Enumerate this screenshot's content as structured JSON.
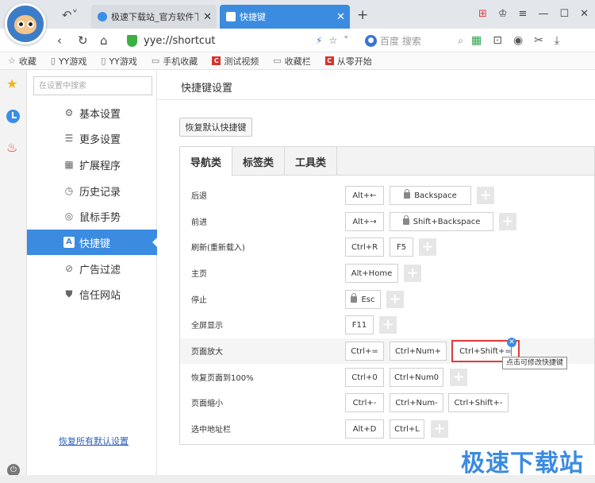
{
  "browser": {
    "tabs": [
      {
        "title": "极速下载站_官方软件下载_",
        "active": false
      },
      {
        "title": "快捷键",
        "active": true
      }
    ],
    "url": "yye://shortcut",
    "search_placeholder": "百度 搜索"
  },
  "bookmarks": [
    {
      "label": "收藏",
      "icon": "star-outline-icon"
    },
    {
      "label": "YY游戏",
      "icon": "page-icon"
    },
    {
      "label": "YY游戏",
      "icon": "page-icon"
    },
    {
      "label": "手机收藏",
      "icon": "folder-icon"
    },
    {
      "label": "测试视频",
      "icon": "red-c-icon"
    },
    {
      "label": "收藏栏",
      "icon": "folder-icon"
    },
    {
      "label": "从零开始",
      "icon": "red-c-icon"
    }
  ],
  "sidebar": {
    "search_placeholder": "在设置中搜索",
    "items": [
      {
        "label": "基本设置",
        "icon": "gear-icon"
      },
      {
        "label": "更多设置",
        "icon": "list-icon"
      },
      {
        "label": "扩展程序",
        "icon": "grid-icon"
      },
      {
        "label": "历史记录",
        "icon": "clock-icon"
      },
      {
        "label": "鼠标手势",
        "icon": "mouse-icon"
      },
      {
        "label": "快捷键",
        "icon": "a-key-icon",
        "active": true
      },
      {
        "label": "广告过滤",
        "icon": "block-icon"
      },
      {
        "label": "信任网站",
        "icon": "shield-icon"
      }
    ],
    "restore_all": "恢复所有默认设置"
  },
  "main": {
    "title": "快捷键设置",
    "restore_button": "恢复默认快捷键",
    "tabs": [
      "导航类",
      "标签类",
      "工具类"
    ],
    "rows": [
      {
        "label": "后退",
        "keys": [
          "Alt+←",
          "Backspace"
        ]
      },
      {
        "label": "前进",
        "keys": [
          "Alt+→",
          "Shift+Backspace"
        ]
      },
      {
        "label": "刷新(重新载入)",
        "keys": [
          "Ctrl+R",
          "F5"
        ]
      },
      {
        "label": "主页",
        "keys": [
          "Alt+Home"
        ]
      },
      {
        "label": "停止",
        "keys": [
          "Esc"
        ]
      },
      {
        "label": "全屏显示",
        "keys": [
          "F11"
        ]
      },
      {
        "label": "页面放大",
        "keys": [
          "Ctrl+=",
          "Ctrl+Num+",
          "Ctrl+Shift+="
        ]
      },
      {
        "label": "恢复页面到100%",
        "keys": [
          "Ctrl+0",
          "Ctrl+Num0"
        ]
      },
      {
        "label": "页面缩小",
        "keys": [
          "Ctrl+-",
          "Ctrl+Num-",
          "Ctrl+Shift+-"
        ]
      },
      {
        "label": "选中地址栏",
        "keys": [
          "Alt+D",
          "Ctrl+L"
        ]
      }
    ],
    "tooltip": "点击可修改快捷键"
  },
  "watermark": "极速下载站",
  "colors": {
    "accent": "#3b8be0",
    "highlight_border": "#e03b3b"
  }
}
